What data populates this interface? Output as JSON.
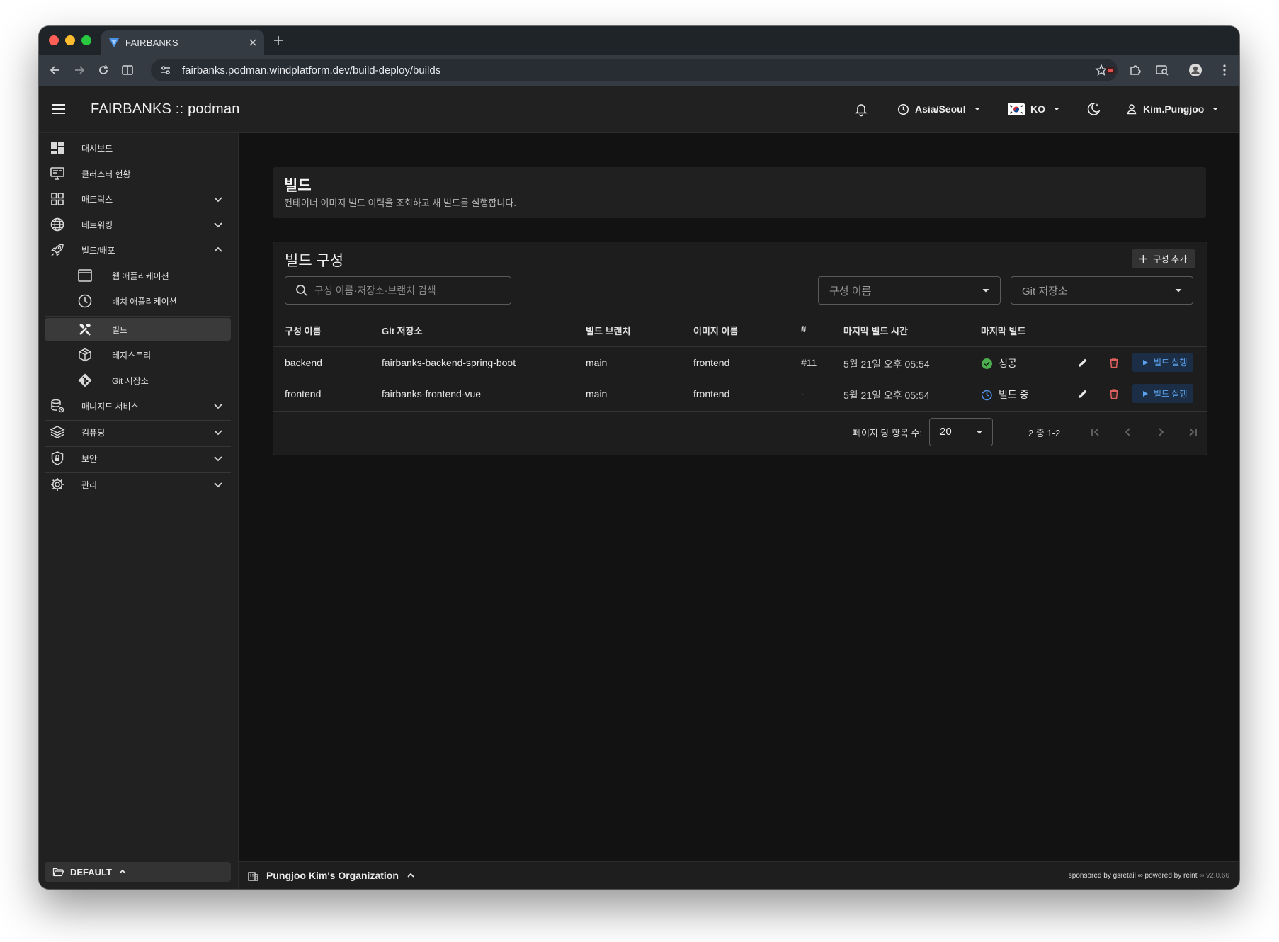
{
  "browser": {
    "tab_title": "FAIRBANKS",
    "url": "fairbanks.podman.windplatform.dev/build-deploy/builds"
  },
  "header": {
    "title": "FAIRBANKS :: podman",
    "timezone": "Asia/Seoul",
    "language": "KO",
    "user": "Kim.Pungjoo"
  },
  "sidebar": {
    "items": [
      {
        "label": "대시보드",
        "icon": "dashboard-icon"
      },
      {
        "label": "클러스터 현황",
        "icon": "monitor-icon"
      },
      {
        "label": "매트릭스",
        "icon": "grid-icon"
      },
      {
        "label": "네트워킹",
        "icon": "globe-icon"
      },
      {
        "label": "빌드/배포",
        "icon": "rocket-icon"
      },
      {
        "label": "웹 애플리케이션",
        "icon": "browser-window-icon"
      },
      {
        "label": "배치 애플리케이션",
        "icon": "clock-icon"
      },
      {
        "label": "빌드",
        "icon": "tools-icon"
      },
      {
        "label": "레지스트리",
        "icon": "cube-icon"
      },
      {
        "label": "Git 저장소",
        "icon": "git-icon"
      },
      {
        "label": "매니지드 서비스",
        "icon": "database-gear-icon"
      },
      {
        "label": "컴퓨팅",
        "icon": "layers-icon"
      },
      {
        "label": "보안",
        "icon": "shield-lock-icon"
      },
      {
        "label": "관리",
        "icon": "gear-icon"
      }
    ],
    "workspace": "DEFAULT"
  },
  "page": {
    "title": "빌드",
    "subtitle": "컨테이너 이미지 빌드 이력을 조회하고 새 빌드를 실행합니다."
  },
  "card": {
    "title": "빌드 구성",
    "add_label": "구성 추가",
    "search_placeholder": "구성 이름·저장소·브랜치 검색",
    "filter_name": "구성 이름",
    "filter_repo": "Git 저장소"
  },
  "table": {
    "columns": [
      "구성 이름",
      "Git 저장소",
      "빌드 브랜치",
      "이미지 이름",
      "#",
      "마지막 빌드 시간",
      "마지막 빌드"
    ],
    "rows": [
      {
        "name": "backend",
        "repo": "fairbanks-backend-spring-boot",
        "branch": "main",
        "image": "frontend",
        "number": "#11",
        "time": "5월 21일 오후 05:54",
        "status": "성공",
        "status_icon": "check-circle-icon",
        "run_label": "빌드 실행"
      },
      {
        "name": "frontend",
        "repo": "fairbanks-frontend-vue",
        "branch": "main",
        "image": "frontend",
        "number": "-",
        "time": "5월 21일 오후 05:54",
        "status": "빌드 중",
        "status_icon": "clock-history-icon",
        "run_label": "빌드 실행"
      }
    ]
  },
  "pagination": {
    "per_page_label": "페이지 당 항목 수:",
    "per_page": "20",
    "range": "2 중 1-2"
  },
  "footer": {
    "org": "Pungjoo Kim's Organization",
    "sponsored": "sponsored by gsretail",
    "powered": "powered by reint",
    "version": "v2.0.66"
  },
  "colors": {
    "success": "#4caf50",
    "running": "#4f8fe0",
    "danger": "#e0625f",
    "accent_blue": "#5aa2ee"
  }
}
